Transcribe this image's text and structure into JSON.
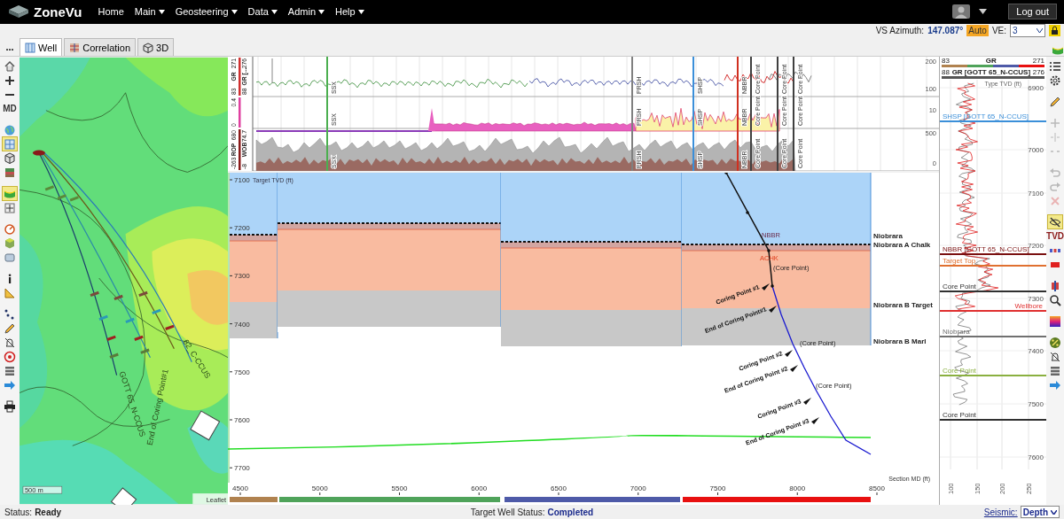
{
  "header": {
    "logo": "ZoneVu",
    "nav": [
      {
        "label": "Home",
        "has_menu": false
      },
      {
        "label": "Main",
        "has_menu": true
      },
      {
        "label": "Geosteering",
        "has_menu": true
      },
      {
        "label": "Data",
        "has_menu": true
      },
      {
        "label": "Admin",
        "has_menu": true
      },
      {
        "label": "Help",
        "has_menu": true
      }
    ],
    "logout": "Log out"
  },
  "view_bar": {
    "azimuth_label": "VS Azimuth:",
    "azimuth_value": "147.087°",
    "auto": "Auto",
    "ve_label": "VE:",
    "ve_value": "3"
  },
  "tabs_bar": {
    "more": "...",
    "tabs": [
      {
        "label": "Well",
        "kind": "well",
        "selected": true
      },
      {
        "label": "Correlation",
        "kind": "correlation",
        "selected": false
      },
      {
        "label": "3D",
        "kind": "cube",
        "selected": false
      }
    ]
  },
  "left_toolbar": [
    {
      "kind": "home",
      "selected": false
    },
    {
      "kind": "zoom-in",
      "selected": false
    },
    {
      "kind": "zoom-out",
      "selected": false
    },
    {
      "kind": "md",
      "label": "MD",
      "selected": false
    },
    {
      "kind": "globe",
      "selected": false
    },
    {
      "kind": "grid",
      "selected": true
    },
    {
      "kind": "cube",
      "selected": false
    },
    {
      "kind": "map-layers",
      "selected": false
    },
    {
      "kind": "horizon",
      "selected": true
    },
    {
      "kind": "crosshair",
      "selected": false
    },
    {
      "kind": "gauge",
      "selected": false
    },
    {
      "kind": "block",
      "selected": false
    },
    {
      "kind": "panel",
      "selected": false
    },
    {
      "kind": "info",
      "selected": false
    },
    {
      "kind": "ruler",
      "selected": false
    },
    {
      "kind": "dots",
      "selected": false
    },
    {
      "kind": "pencil",
      "selected": false
    },
    {
      "kind": "bell",
      "selected": false
    },
    {
      "kind": "target",
      "selected": false
    },
    {
      "kind": "stack",
      "selected": false
    },
    {
      "kind": "arrow",
      "selected": false
    },
    {
      "kind": "printer",
      "selected": false
    }
  ],
  "map": {
    "well_labels": [
      "GOTT 65_N-CCUS",
      "62_C-CCUS",
      "End of Coring Point#1"
    ],
    "scale_label": "500 m",
    "attribution": "Leaflet"
  },
  "log_tracks": [
    {
      "headers": [
        [
          "83",
          "GR",
          "271"
        ],
        [
          "88",
          "GR [...",
          "276"
        ]
      ],
      "scale": [
        "200",
        "100"
      ]
    },
    {
      "headers": [
        [
          "0",
          "0.4"
        ]
      ],
      "scale": [
        "10"
      ]
    },
    {
      "headers": [
        [
          "-263",
          "ROP",
          "680"
        ],
        [
          "-8",
          "WOB",
          "74.7"
        ]
      ],
      "scale": [
        "500",
        "0"
      ]
    }
  ],
  "log_markers": [
    {
      "color": "#4caf50",
      "labels": [
        "SSX",
        "SSX",
        "SSX"
      ]
    },
    {
      "color": "#808080",
      "labels": [
        "PRSH",
        "PRSH",
        "PRSH"
      ]
    },
    {
      "color": "#3b8fd9",
      "labels": [
        "SHSP",
        "SHSP",
        "SHSP"
      ]
    },
    {
      "color": "#d03020",
      "labels": [
        "NBBR",
        "NBBR",
        "NBBR"
      ]
    },
    {
      "color": "#404040",
      "labels": [
        "Core Point",
        "Core Point",
        "Core Point"
      ]
    },
    {
      "color": "#404040",
      "labels": [
        "Core Point",
        "Core Point",
        "Core Point"
      ]
    },
    {
      "color": "#404040",
      "labels": [
        "Core Point",
        "Core Point",
        "Core Point"
      ]
    }
  ],
  "section": {
    "tvd_title": "Target TVD (ft)",
    "tvd_ticks": [
      "7100",
      "7200",
      "7300",
      "7400",
      "7500",
      "7600",
      "7700"
    ],
    "md_title": "Section MD (ft)",
    "md_ticks": [
      "4500",
      "5000",
      "5500",
      "6000",
      "6500",
      "7000",
      "7500",
      "8000",
      "8500"
    ],
    "formations": [
      {
        "label": "Niobrara",
        "color": "#d2a6a2"
      },
      {
        "label": "Niobrara A Chalk",
        "color": "#f9bba0"
      },
      {
        "label": "Niobrara B Target",
        "color": "#c8c8c8"
      },
      {
        "label": "Niobrara B Marl",
        "color": "#ffffff"
      }
    ],
    "top_labels": [
      "NBBR",
      "ACHK"
    ],
    "well_labels": [
      {
        "kind": "core",
        "text": "(Core Point)"
      },
      {
        "kind": "point",
        "text": "Coring Point #1"
      },
      {
        "kind": "point",
        "text": "End of Coring Point#1"
      },
      {
        "kind": "core",
        "text": "(Core Point)"
      },
      {
        "kind": "point",
        "text": "Coring Point #2"
      },
      {
        "kind": "point",
        "text": "End of Coring Point #2"
      },
      {
        "kind": "core",
        "text": "(Core Point)"
      },
      {
        "kind": "point",
        "text": "Coring Point #3"
      },
      {
        "kind": "point",
        "text": "End of Coring Point #3"
      }
    ],
    "md_segments": [
      {
        "color": "#b0824f"
      },
      {
        "color": "#4fa35a"
      },
      {
        "color": "#4e5aa8"
      },
      {
        "color": "#e81010"
      }
    ]
  },
  "type_log": {
    "header": [
      {
        "min": "83",
        "name": "GR",
        "max": "271"
      },
      {
        "min": "88",
        "name": "GR [GOTT 65_N-CCUS]",
        "max": "276"
      }
    ],
    "axis_title": "Type TVD (ft)",
    "tvd_ticks": [
      "6900",
      "7000",
      "7100",
      "7200",
      "7300",
      "7400",
      "7500",
      "7600"
    ],
    "x_ticks": [
      "100",
      "150",
      "200",
      "250"
    ],
    "markers": [
      {
        "label": "SHSP [GOTT 65_N-CCUS]",
        "color": "#3b8fd9"
      },
      {
        "label": "NBBR [GOTT 65_N-CCUS]",
        "color": "#7a1010"
      },
      {
        "label": "Target Top",
        "color": "#e07030"
      },
      {
        "label": "Core Point",
        "color": "#303030"
      },
      {
        "label": "Wellbore",
        "color": "#e03030"
      },
      {
        "label": "Niobrara",
        "color": "#707070"
      },
      {
        "label": "Core Point",
        "color": "#8ab040"
      },
      {
        "label": "Core Point",
        "color": "#303030"
      }
    ]
  },
  "right_toolbar": [
    {
      "kind": "list",
      "selected": false,
      "disabled": false
    },
    {
      "kind": "gear",
      "selected": false,
      "disabled": false
    },
    {
      "kind": "pencil",
      "selected": false,
      "disabled": false
    },
    {
      "kind": "plus",
      "selected": false,
      "disabled": true
    },
    {
      "kind": "split",
      "selected": false,
      "disabled": true
    },
    {
      "kind": "collapse",
      "selected": false,
      "disabled": true
    },
    {
      "kind": "undo",
      "selected": false,
      "disabled": true
    },
    {
      "kind": "redo",
      "selected": false,
      "disabled": true
    },
    {
      "kind": "close",
      "selected": false,
      "disabled": true
    },
    {
      "kind": "eye-off",
      "selected": true,
      "disabled": false
    },
    {
      "kind": "tvd",
      "label": "TVD",
      "selected": false,
      "disabled": false
    },
    {
      "kind": "bars",
      "selected": false,
      "disabled": false
    },
    {
      "kind": "bar",
      "selected": false,
      "disabled": false
    },
    {
      "kind": "split-red",
      "selected": false,
      "disabled": false
    },
    {
      "kind": "search",
      "selected": false,
      "disabled": false
    },
    {
      "kind": "gradient",
      "selected": false,
      "disabled": false
    },
    {
      "kind": "percent",
      "selected": false,
      "disabled": false
    },
    {
      "kind": "bell",
      "selected": false,
      "disabled": false
    },
    {
      "kind": "stack",
      "selected": false,
      "disabled": false
    },
    {
      "kind": "arrow",
      "selected": false,
      "disabled": false
    }
  ],
  "status_bar": {
    "status_label": "Status:",
    "status_value": "Ready",
    "target_label": "Target Well Status:",
    "target_value": "Completed",
    "seismic_label": "Seismic:",
    "seismic_value": "Depth"
  }
}
